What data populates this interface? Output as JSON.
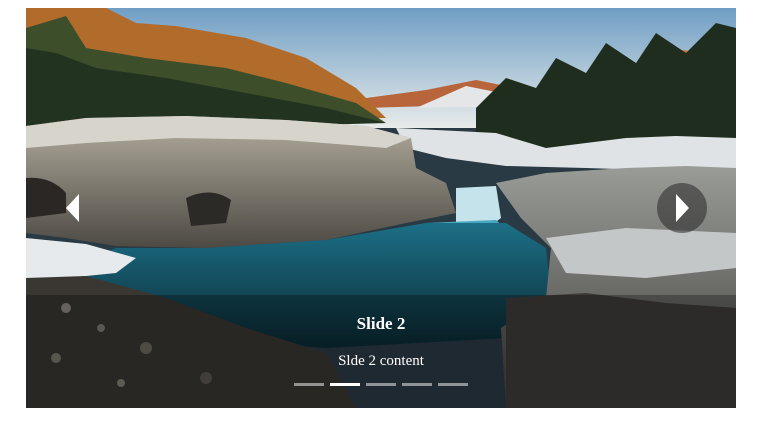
{
  "carousel": {
    "active_index": 1,
    "slide": {
      "title": "Slide 2",
      "content": "Slde 2 content"
    },
    "indicator_count": 5,
    "controls": {
      "prev_icon": "chevron-left-icon",
      "next_icon": "chevron-right-icon"
    }
  },
  "colors": {
    "indicator_active": "#ffffff",
    "indicator_inactive": "#bfbfbf",
    "caption_text": "#ffffff"
  }
}
